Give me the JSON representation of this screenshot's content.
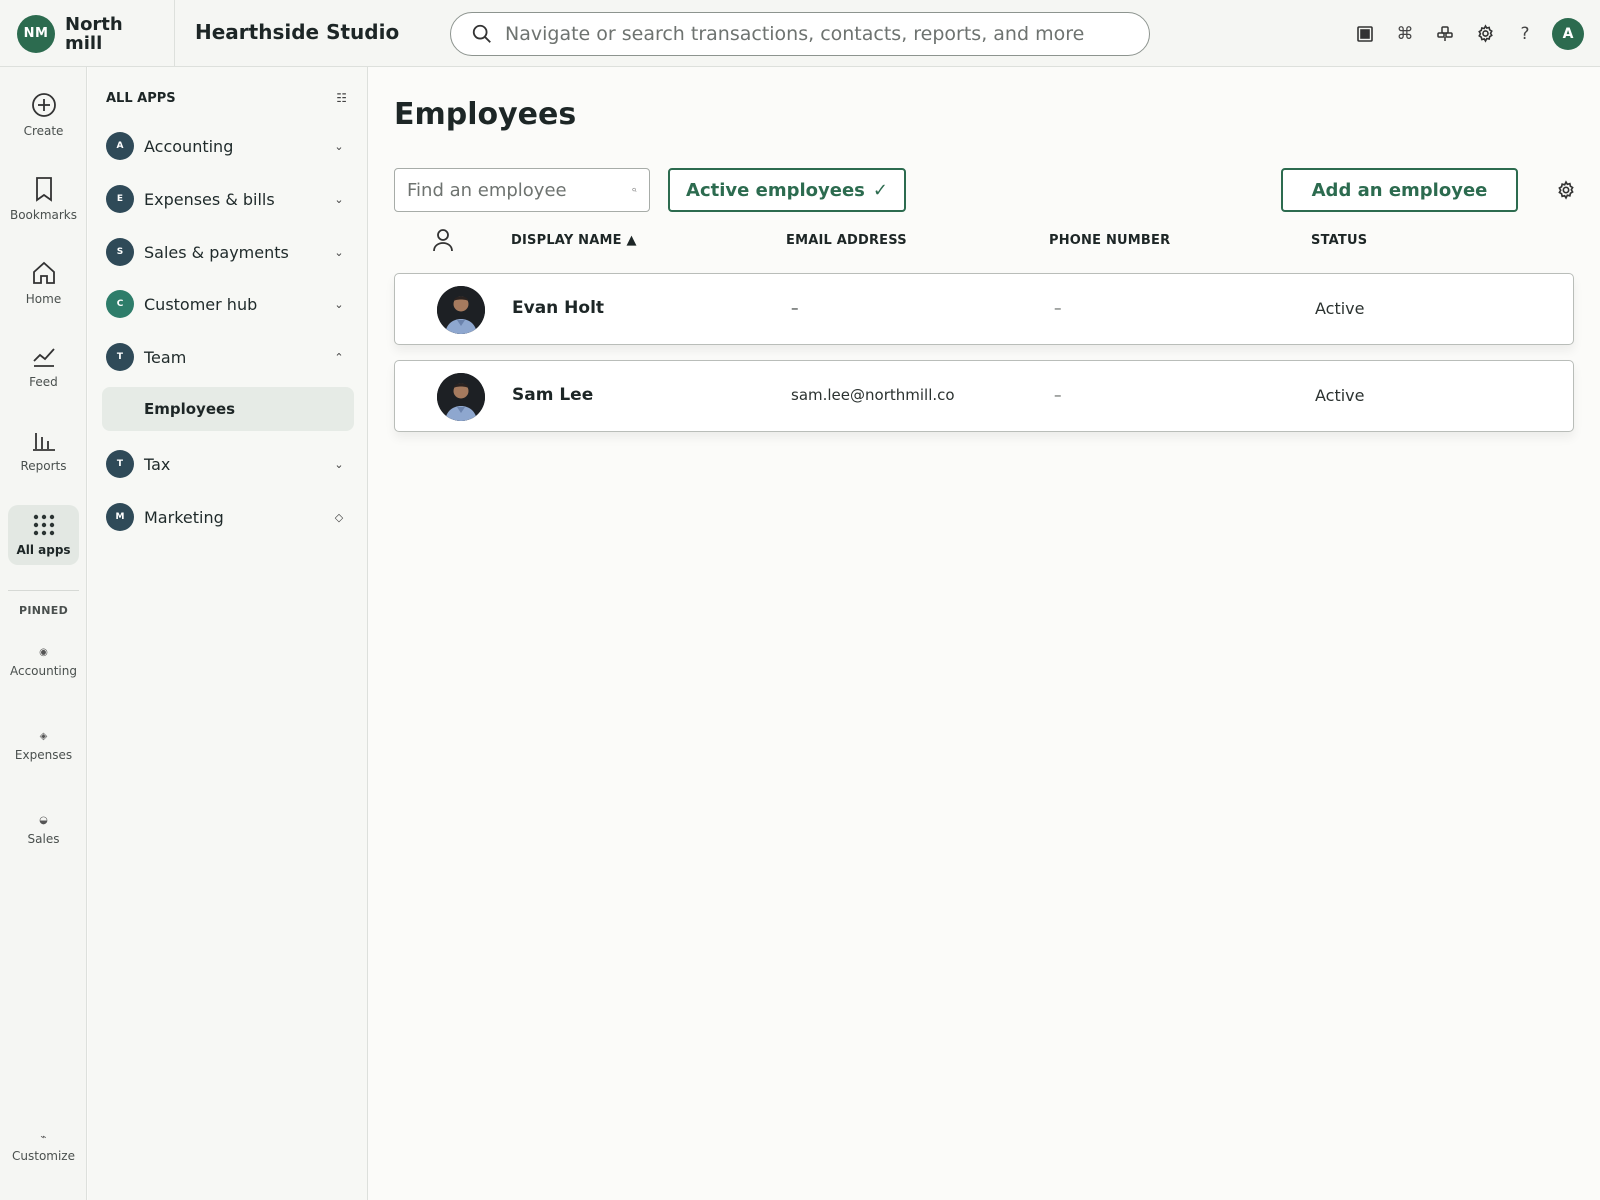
{
  "brand": {
    "initials": "NM",
    "name": "North mill"
  },
  "company_name": "Hearthside Studio",
  "search": {
    "placeholder": "Navigate or search transactions, contacts, reports, and more"
  },
  "top_icons": [
    "window-icon",
    "command-icon",
    "apps-hub-icon",
    "gear-icon",
    "help-icon"
  ],
  "user": {
    "initial": "A"
  },
  "rail": {
    "items": [
      {
        "label": "Create",
        "icon": "plus-circle-icon"
      },
      {
        "label": "Bookmarks",
        "icon": "bookmark-icon"
      },
      {
        "label": "Home",
        "icon": "home-icon"
      },
      {
        "label": "Feed",
        "icon": "feed-icon"
      },
      {
        "label": "Reports",
        "icon": "reports-icon"
      },
      {
        "label": "All apps",
        "icon": "grid-icon"
      }
    ],
    "pinned_header": "PINNED",
    "pinned": [
      {
        "label": "Accounting",
        "glyph": "◉"
      },
      {
        "label": "Expenses",
        "glyph": "◈"
      },
      {
        "label": "Sales",
        "glyph": "◒"
      }
    ],
    "customize": {
      "label": "Customize",
      "glyph": "⌁"
    }
  },
  "apps": {
    "header": "ALL APPS",
    "items": [
      {
        "letter": "A",
        "label": "Accounting",
        "chev": "⌄"
      },
      {
        "letter": "E",
        "label": "Expenses & bills",
        "chev": "⌄"
      },
      {
        "letter": "S",
        "label": "Sales & payments",
        "chev": "⌄"
      },
      {
        "letter": "C",
        "label": "Customer hub",
        "chev": "⌄"
      },
      {
        "letter": "T",
        "label": "Team",
        "chev": "⌃"
      },
      {
        "letter": "T",
        "label": "Tax",
        "chev": "⌄"
      },
      {
        "letter": "M",
        "label": "Marketing",
        "chev": "◇"
      }
    ],
    "sub_item": "Employees"
  },
  "page": {
    "title": "Employees",
    "find_placeholder": "Find an employee",
    "filter_label": "Active employees",
    "filter_check": "✓",
    "add_label": "Add an employee"
  },
  "table": {
    "columns": {
      "display_name": "DISPLAY NAME ▲",
      "email": "EMAIL ADDRESS",
      "phone": "PHONE NUMBER",
      "status": "STATUS"
    },
    "rows": [
      {
        "name": "Evan Holt",
        "email": "–",
        "phone": "–",
        "status": "Active"
      },
      {
        "name": "Sam Lee",
        "email": "sam.lee@northmill.co",
        "phone": "–",
        "status": "Active"
      }
    ]
  },
  "colors": {
    "accent": "#2c6b4f",
    "badge": "#2f4a58"
  }
}
